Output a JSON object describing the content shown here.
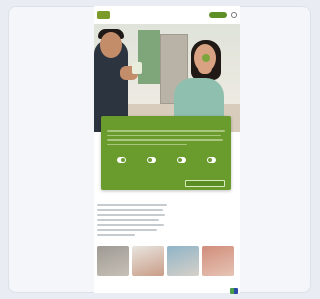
{
  "nav": {
    "items": [
      "",
      "",
      "",
      "",
      ""
    ],
    "cta": ""
  },
  "hero": {},
  "main": {
    "headline": "",
    "paragraph_lines": 7
  },
  "thumbnails": [
    {
      "caption": "",
      "sub": "",
      "color1": "#9e9a93",
      "color2": "#c7c0b7"
    },
    {
      "caption": "",
      "sub": "",
      "color1": "#e8e5e0",
      "color2": "#c99c86"
    },
    {
      "caption": "",
      "sub": "",
      "color1": "#8fb4c8",
      "color2": "#d6d0c8"
    },
    {
      "caption": "",
      "sub": "",
      "color1": "#d18d7b",
      "color2": "#e6c4b4"
    }
  ],
  "cookie": {
    "title": "",
    "link": "",
    "toggles": [
      {
        "label": "",
        "on": true
      },
      {
        "label": "",
        "on": false
      },
      {
        "label": "",
        "on": false
      },
      {
        "label": "",
        "on": false
      }
    ],
    "reject_label": "",
    "accept_label": ""
  },
  "colors": {
    "brand_green": "#6a9c2d",
    "dark_green": "#5e8f27",
    "page_bg": "#e9ecf2"
  }
}
